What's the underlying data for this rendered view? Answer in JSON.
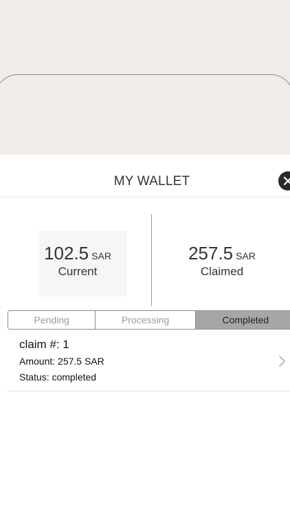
{
  "wallet": {
    "title": "MY WALLET",
    "close_icon": "close-icon",
    "current": {
      "value": "102.5",
      "unit": "SAR",
      "label": "Current"
    },
    "claimed": {
      "value": "257.5",
      "unit": "SAR",
      "label": "Claimed"
    },
    "tabs": [
      {
        "label": "Pending",
        "selected": false
      },
      {
        "label": "Processing",
        "selected": false
      },
      {
        "label": "Completed",
        "selected": true
      }
    ],
    "claims": [
      {
        "title": "claim #: 1",
        "amount": "Amount: 257.5 SAR",
        "status": "Status: completed",
        "chevron_icon": "chevron-right-icon"
      }
    ]
  },
  "colors": {
    "backdrop": "#f0ece9",
    "selected_tab": "#a6a6a6",
    "close_button": "#2a2a2a"
  }
}
